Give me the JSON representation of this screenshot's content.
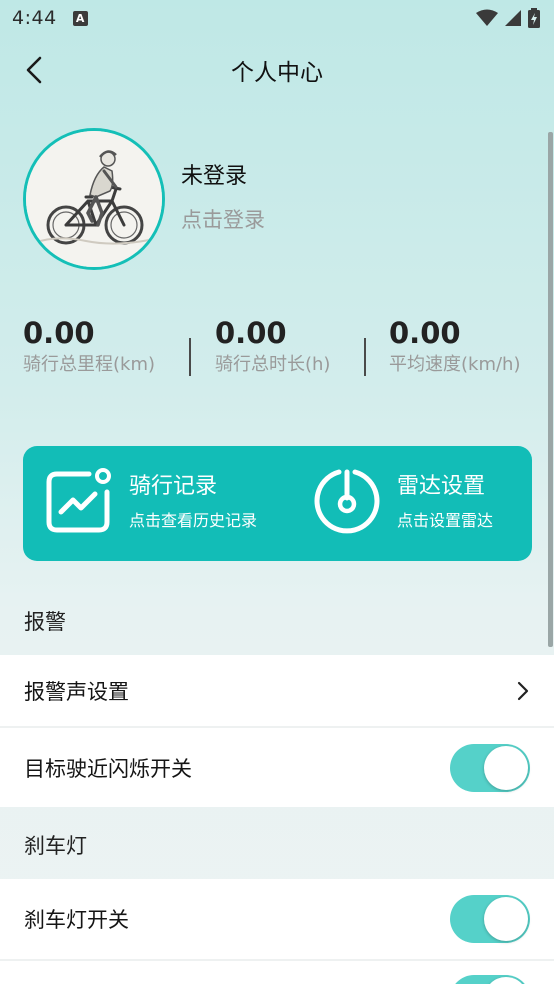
{
  "status_bar": {
    "time": "4:44",
    "notification": "A"
  },
  "header": {
    "title": "个人中心"
  },
  "profile": {
    "username": "未登录",
    "login_link": "点击登录"
  },
  "stats": [
    {
      "value": "0.00",
      "label": "骑行总里程(km)"
    },
    {
      "value": "0.00",
      "label": "骑行总时长(h)"
    },
    {
      "value": "0.00",
      "label": "平均速度(km/h)"
    }
  ],
  "actions": {
    "ride_record": {
      "title": "骑行记录",
      "subtitle": "点击查看历史记录"
    },
    "radar_settings": {
      "title": "雷达设置",
      "subtitle": "点击设置雷达"
    }
  },
  "sections": {
    "alarm": {
      "title": "报警",
      "alarm_sound": "报警声设置",
      "flash_switch": "目标驶近闪烁开关",
      "flash_switch_on": true
    },
    "brake_light": {
      "title": "刹车灯",
      "brake_switch": "刹车灯开关",
      "brake_switch_on": true
    }
  },
  "colors": {
    "accent": "#12bdb7",
    "toggle_on": "#55d1c9"
  }
}
